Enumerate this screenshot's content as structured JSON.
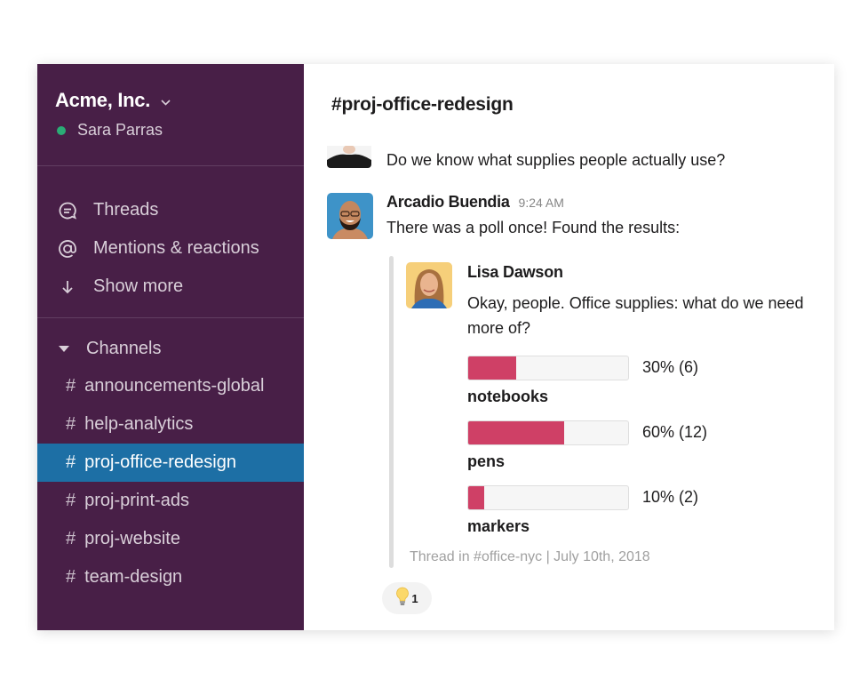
{
  "sidebar": {
    "team_name": "Acme, Inc.",
    "user_name": "Sara Parras",
    "presence_color": "#2bac76",
    "nav_items": [
      {
        "label": "Threads",
        "icon": "threads-icon"
      },
      {
        "label": "Mentions & reactions",
        "icon": "at-sign-icon"
      },
      {
        "label": "Show more",
        "icon": "arrow-down-icon"
      }
    ],
    "channels_header": "Channels",
    "channels": [
      {
        "name": "announcements-global",
        "active": false
      },
      {
        "name": "help-analytics",
        "active": false
      },
      {
        "name": "proj-office-redesign",
        "active": true
      },
      {
        "name": "proj-print-ads",
        "active": false
      },
      {
        "name": "proj-website",
        "active": false
      },
      {
        "name": "team-design",
        "active": false
      }
    ],
    "hash_symbol": "#"
  },
  "main": {
    "channel_title": "#proj-office-redesign",
    "previous_message": {
      "text": "Do we know what supplies people actually use?"
    },
    "message": {
      "author": "Arcadio Buendia",
      "timestamp": "9:24 AM",
      "text": "There was a poll once! Found the results:",
      "attachment": {
        "author": "Lisa Dawson",
        "text": "Okay, people. Office supplies: what do we need more of?",
        "poll": [
          {
            "option": "notebooks",
            "percent": 30,
            "count": 6,
            "value_label": "30% (6)"
          },
          {
            "option": "pens",
            "percent": 60,
            "count": 12,
            "value_label": "60% (12)"
          },
          {
            "option": "markers",
            "percent": 10,
            "count": 2,
            "value_label": "10% (2)"
          }
        ],
        "footer": "Thread in #office-nyc | July 10th, 2018"
      },
      "reaction": {
        "emoji": "lightbulb-icon",
        "count": "1"
      }
    }
  },
  "colors": {
    "sidebar_bg": "#481f47",
    "active_channel": "#1d6fa5",
    "poll_fill": "#cf4066"
  }
}
